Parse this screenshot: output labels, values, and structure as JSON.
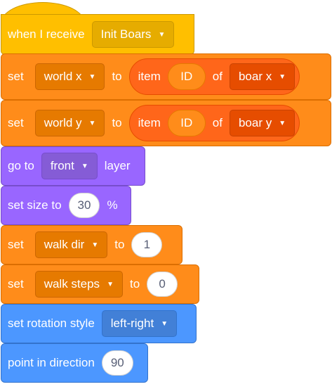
{
  "blocks": {
    "when_receive": {
      "label": "when I receive",
      "message": "Init Boars"
    },
    "set_world_x": {
      "label": "set",
      "variable": "world x",
      "to": "to",
      "item": "item",
      "index": "ID",
      "of": "of",
      "list": "boar x"
    },
    "set_world_y": {
      "label": "set",
      "variable": "world y",
      "to": "to",
      "item": "item",
      "index": "ID",
      "of": "of",
      "list": "boar y"
    },
    "go_to_layer": {
      "label": "go to",
      "layer": "front",
      "suffix": "layer"
    },
    "set_size": {
      "label": "set size to",
      "value": "30",
      "suffix": "%"
    },
    "set_walk_dir": {
      "label": "set",
      "variable": "walk dir",
      "to": "to",
      "value": "1"
    },
    "set_walk_steps": {
      "label": "set",
      "variable": "walk steps",
      "to": "to",
      "value": "0"
    },
    "set_rotation": {
      "label": "set rotation style",
      "style": "left-right"
    },
    "point_direction": {
      "label": "point in direction",
      "value": "90"
    }
  },
  "colors": {
    "events": "#ffbf00",
    "variables": "#ff8c1a",
    "lists": "#ff661a",
    "looks": "#9966ff",
    "motion": "#4c97ff"
  },
  "icons": {
    "dropdown": "dropdown-arrow-icon"
  }
}
